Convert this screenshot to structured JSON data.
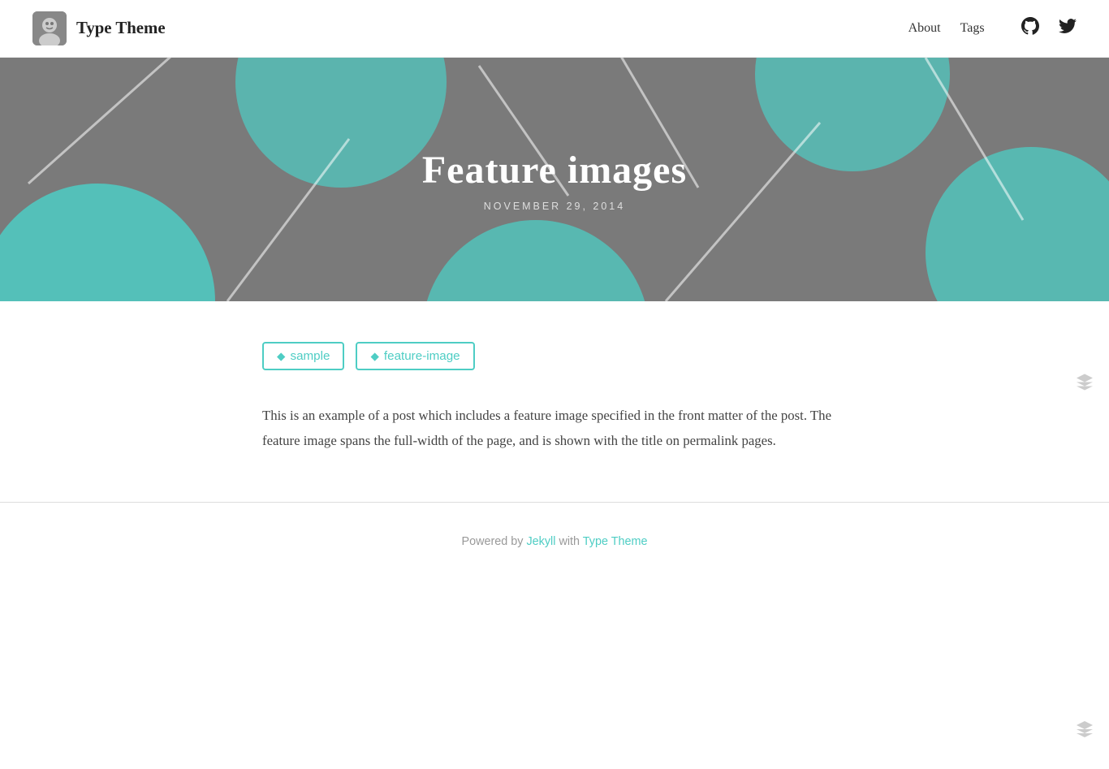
{
  "nav": {
    "title": "Type Theme",
    "links": [
      {
        "label": "About",
        "href": "#"
      },
      {
        "label": "Tags",
        "href": "#"
      }
    ],
    "github_label": "github-icon",
    "twitter_label": "twitter-icon"
  },
  "hero": {
    "title": "Feature images",
    "date": "NOVEMBER 29, 2014",
    "bg_color": "#7a7a7a",
    "accent_color": "#4ecdc4"
  },
  "tags": [
    {
      "label": "sample",
      "href": "#"
    },
    {
      "label": "feature-image",
      "href": "#"
    }
  ],
  "post": {
    "body": "This is an example of a post which includes a feature image specified in the front matter of the post. The feature image spans the full-width of the page, and is shown with the title on permalink pages."
  },
  "footer": {
    "text_before": "Powered by ",
    "jekyll_label": "Jekyll",
    "text_middle": " with ",
    "theme_label": "Type Theme"
  }
}
